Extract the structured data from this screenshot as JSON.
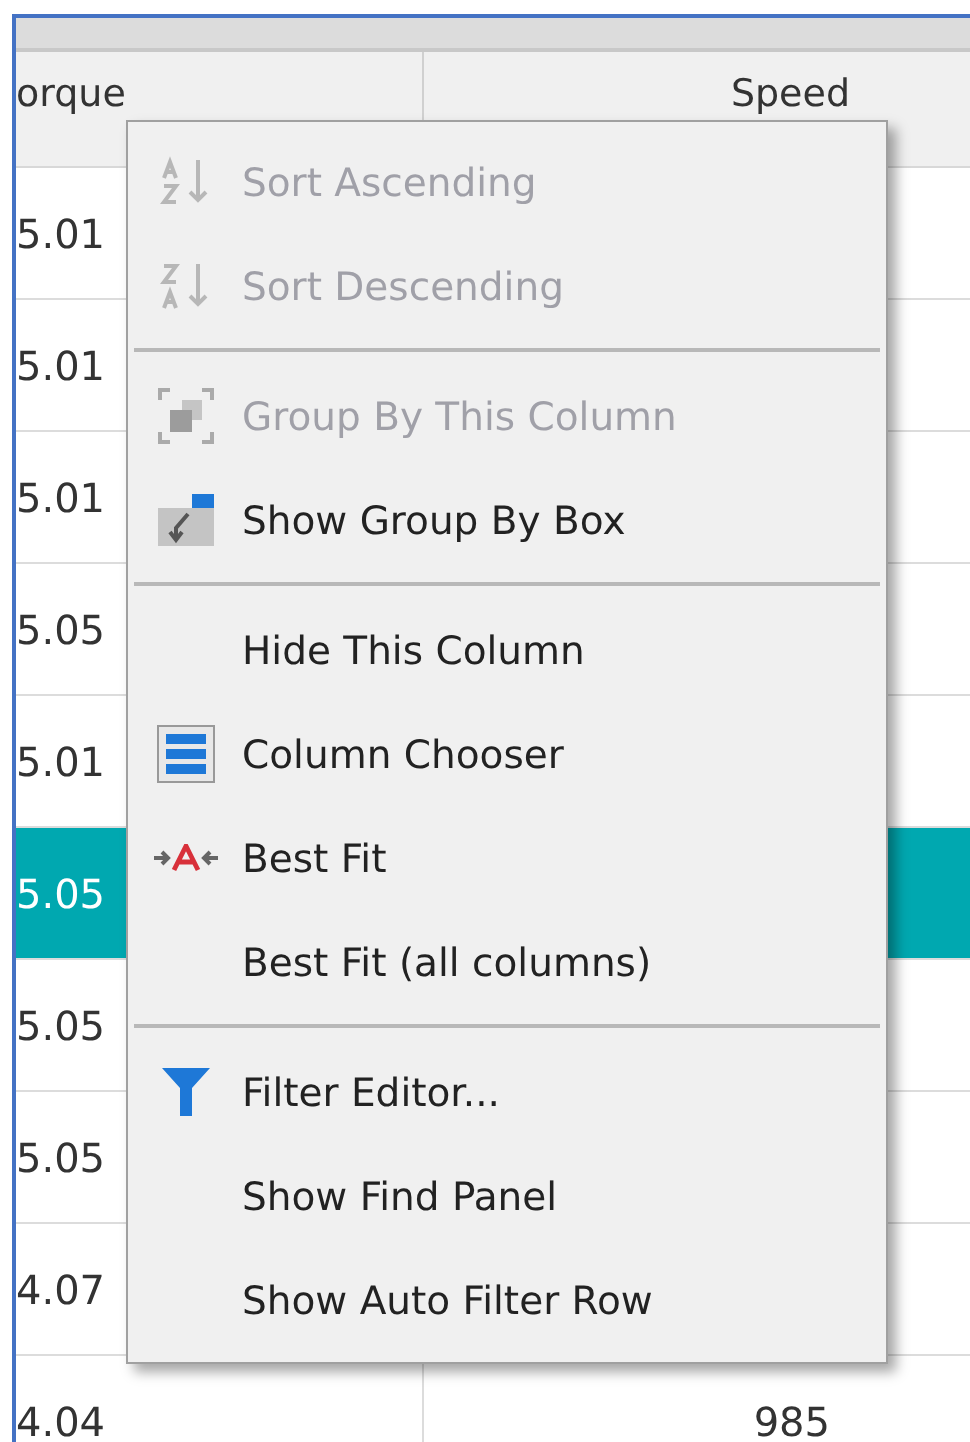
{
  "grid": {
    "columns": [
      {
        "label": "orque"
      },
      {
        "label": "Speed"
      }
    ],
    "rows": [
      {
        "torque": "5.01",
        "selected": false
      },
      {
        "torque": "5.01",
        "selected": false
      },
      {
        "torque": "5.01",
        "selected": false
      },
      {
        "torque": "5.05",
        "selected": false
      },
      {
        "torque": "5.01",
        "selected": false
      },
      {
        "torque": "5.05",
        "selected": true
      },
      {
        "torque": "5.05",
        "selected": false
      },
      {
        "torque": "5.05",
        "selected": false
      },
      {
        "torque": "4.07",
        "selected": false
      },
      {
        "torque": "4.04",
        "speed": "985",
        "selected": false
      }
    ]
  },
  "context_menu": {
    "items": [
      {
        "kind": "item",
        "label": "Sort Ascending",
        "disabled": true
      },
      {
        "kind": "item",
        "label": "Sort Descending",
        "disabled": true
      },
      {
        "kind": "separator"
      },
      {
        "kind": "item",
        "label": "Group By This Column",
        "disabled": true
      },
      {
        "kind": "item",
        "label": "Show Group By Box",
        "disabled": false
      },
      {
        "kind": "separator"
      },
      {
        "kind": "item",
        "label": "Hide This Column",
        "disabled": false
      },
      {
        "kind": "item",
        "label": "Column Chooser",
        "disabled": false
      },
      {
        "kind": "item",
        "label": "Best Fit",
        "disabled": false
      },
      {
        "kind": "item",
        "label": "Best Fit (all columns)",
        "disabled": false
      },
      {
        "kind": "separator"
      },
      {
        "kind": "item",
        "label": "Filter Editor...",
        "disabled": false
      },
      {
        "kind": "item",
        "label": "Show Find Panel",
        "disabled": false
      },
      {
        "kind": "item",
        "label": "Show Auto Filter Row",
        "disabled": false
      }
    ]
  }
}
